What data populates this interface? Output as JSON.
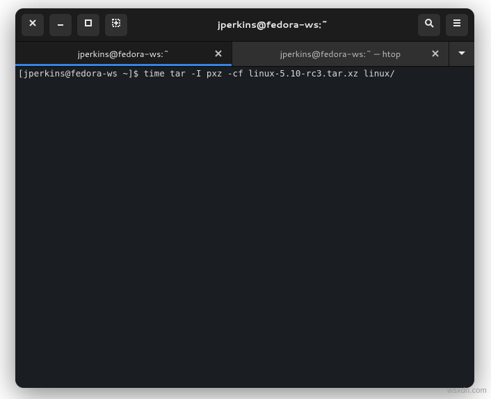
{
  "window": {
    "title": "jperkins@fedora-ws:~"
  },
  "tabs": [
    {
      "label": "jperkins@fedora-ws:~",
      "active": true
    },
    {
      "label": "jperkins@fedora-ws:~ — htop",
      "active": false
    }
  ],
  "terminal": {
    "prompt": "[jperkins@fedora-ws ~]$ ",
    "command": "time tar -I pxz -cf linux-5.10-rc3.tar.xz linux/"
  },
  "watermark": "wsxdn.com",
  "icons": {
    "close": "close-icon",
    "minimize": "minimize-icon",
    "maximize": "maximize-icon",
    "newtab": "new-tab-icon",
    "search": "search-icon",
    "menu": "hamburger-menu-icon",
    "chevron": "chevron-down-icon"
  },
  "colors": {
    "accent": "#3584e4",
    "titlebar": "#1c1c1c",
    "terminal_bg": "#1a1d21"
  }
}
